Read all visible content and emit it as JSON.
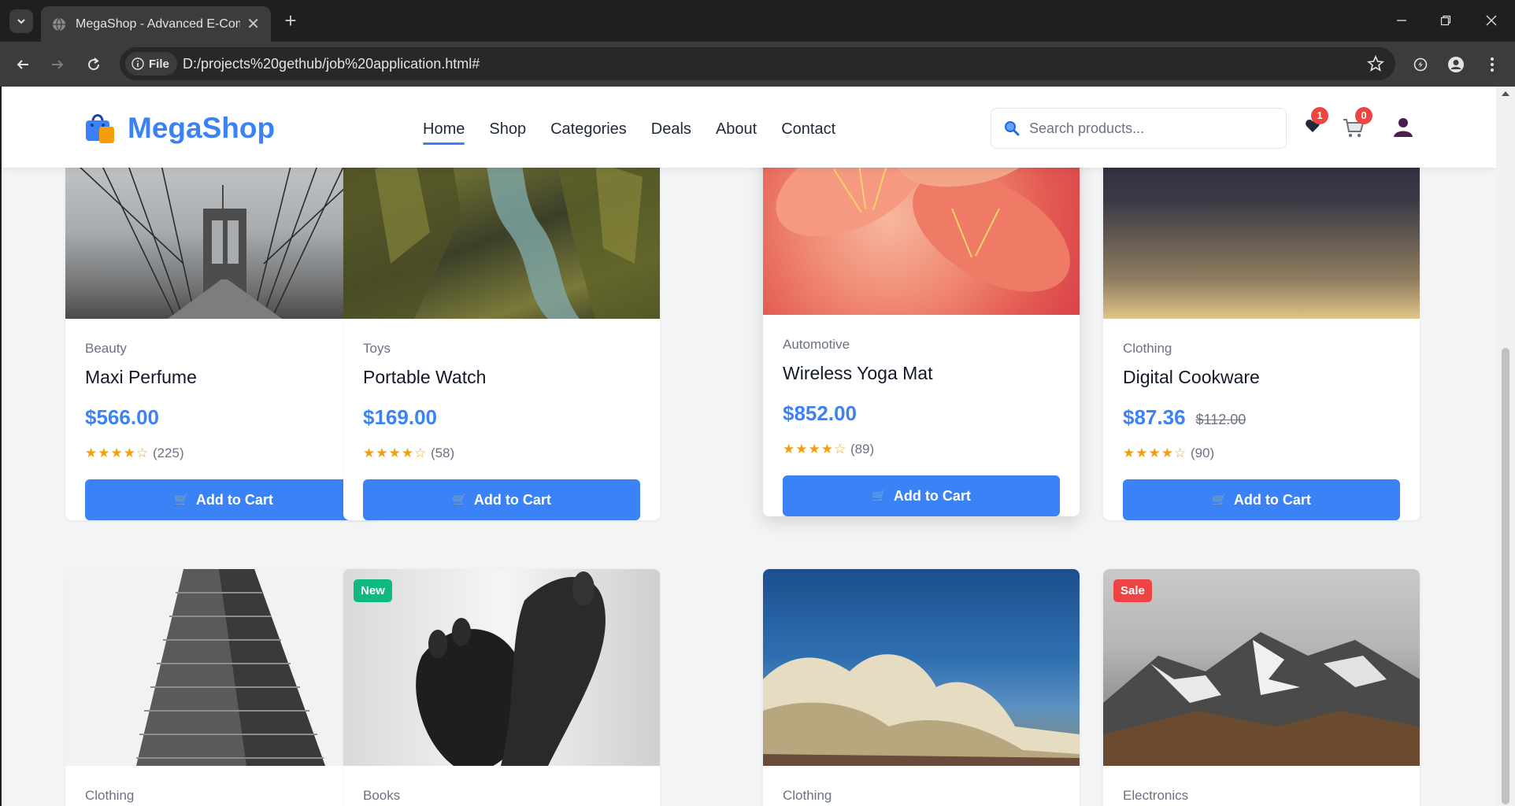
{
  "browser": {
    "tab_title": "MegaShop - Advanced E-Comm",
    "url_chip": "File",
    "url": "D:/projects%20gethub/job%20application.html#"
  },
  "header": {
    "logo_text": "MegaShop",
    "nav": [
      {
        "label": "Home",
        "active": true
      },
      {
        "label": "Shop"
      },
      {
        "label": "Categories"
      },
      {
        "label": "Deals"
      },
      {
        "label": "About"
      },
      {
        "label": "Contact"
      }
    ],
    "search_placeholder": "Search products...",
    "wishlist_count": "1",
    "cart_count": "0"
  },
  "products": [
    {
      "category": "Beauty",
      "name": "Maxi Perfume",
      "price": "$566.00",
      "old_price": "",
      "stars": "★★★★☆",
      "reviews": "(225)",
      "button": "Add to Cart"
    },
    {
      "category": "Toys",
      "name": "Portable Watch",
      "price": "$169.00",
      "old_price": "",
      "stars": "★★★★☆",
      "reviews": "(58)",
      "button": "Add to Cart"
    },
    {
      "category": "Automotive",
      "name": "Wireless Yoga Mat",
      "price": "$852.00",
      "old_price": "",
      "stars": "★★★★☆",
      "reviews": "(89)",
      "button": "Add to Cart"
    },
    {
      "category": "Clothing",
      "name": "Digital Cookware",
      "price": "$87.36",
      "old_price": "$112.00",
      "stars": "★★★★☆",
      "reviews": "(90)",
      "button": "Add to Cart"
    },
    {
      "category": "Clothing",
      "tag": ""
    },
    {
      "category": "Books",
      "tag": "New"
    },
    {
      "category": "Clothing",
      "tag": ""
    },
    {
      "category": "Electronics",
      "tag": "Sale"
    }
  ],
  "colors": {
    "accent": "#3b82f6",
    "new_tag": "#10b981",
    "sale_tag": "#ef4444",
    "star": "#f59e0b"
  },
  "icons": {
    "cart_button": "cart-icon",
    "wishlist": "heart-icon"
  }
}
